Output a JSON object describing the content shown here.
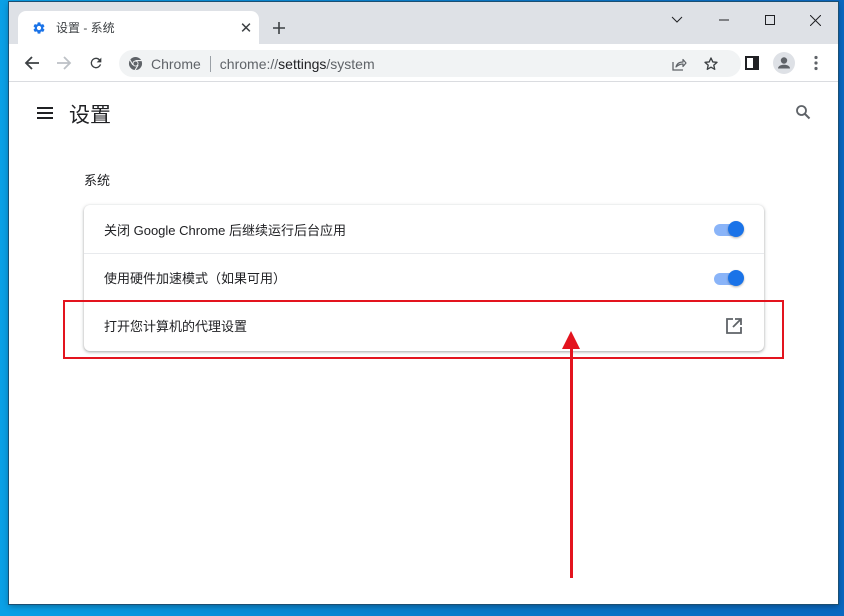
{
  "browser": {
    "tab": {
      "title": "设置 - 系统",
      "icon": "gear-icon"
    },
    "new_tab_icon": "plus-icon",
    "window_controls": [
      "tab-search-chevron",
      "minimize",
      "maximize",
      "close"
    ],
    "omnibox": {
      "site_label": "Chrome",
      "url_scheme": "chrome://",
      "url_host": "settings",
      "url_path": "/system"
    },
    "accent_color": "#1a73e8"
  },
  "settings": {
    "page_title": "设置",
    "section_title": "系统",
    "rows": [
      {
        "label": "关闭 Google Chrome 后继续运行后台应用",
        "control": "toggle",
        "checked": true
      },
      {
        "label": "使用硬件加速模式（如果可用）",
        "control": "toggle",
        "checked": true
      },
      {
        "label": "打开您计算机的代理设置",
        "control": "external-link"
      }
    ]
  },
  "annotation": {
    "highlight_color": "#e3141e",
    "highlighted_row": "打开您计算机的代理设置"
  }
}
